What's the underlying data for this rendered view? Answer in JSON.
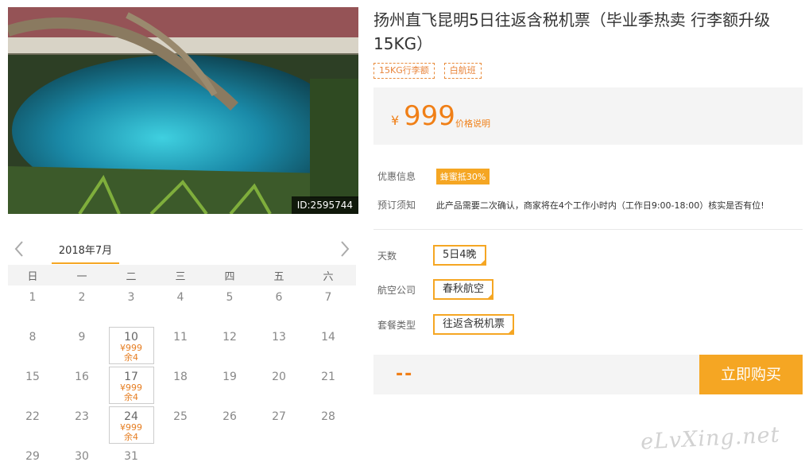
{
  "product": {
    "title": "扬州直飞昆明5日往返含税机票（毕业季热卖 行李额升级15KG）",
    "tags": [
      "15KG行李额",
      "白航班"
    ],
    "image_id": "ID:2595744"
  },
  "price": {
    "currency": "¥",
    "value": "999",
    "explain_label": "价格说明"
  },
  "info": {
    "promo_label": "优惠信息",
    "promo_badge": "蜂蜜抵30%",
    "notice_label": "预订须知",
    "notice_text": "此产品需要二次确认，商家将在4个工作小时内（工作日9:00-18:00）核实是否有位!"
  },
  "options": [
    {
      "label": "天数",
      "value": "5日4晚"
    },
    {
      "label": "航空公司",
      "value": "春秋航空"
    },
    {
      "label": "套餐类型",
      "value": "往返含税机票"
    }
  ],
  "buy": {
    "total": "--",
    "button_label": "立即购买"
  },
  "calendar": {
    "month_label": "2018年7月",
    "weekdays": [
      "日",
      "一",
      "二",
      "三",
      "四",
      "五",
      "六"
    ],
    "days": [
      {
        "d": "1"
      },
      {
        "d": "2"
      },
      {
        "d": "3"
      },
      {
        "d": "4"
      },
      {
        "d": "5"
      },
      {
        "d": "6"
      },
      {
        "d": "7"
      },
      {
        "d": "8"
      },
      {
        "d": "9"
      },
      {
        "d": "10",
        "price": "¥999",
        "left": "余4"
      },
      {
        "d": "11"
      },
      {
        "d": "12"
      },
      {
        "d": "13"
      },
      {
        "d": "14"
      },
      {
        "d": "15"
      },
      {
        "d": "16"
      },
      {
        "d": "17",
        "price": "¥999",
        "left": "余4"
      },
      {
        "d": "18"
      },
      {
        "d": "19"
      },
      {
        "d": "20"
      },
      {
        "d": "21"
      },
      {
        "d": "22"
      },
      {
        "d": "23"
      },
      {
        "d": "24",
        "price": "¥999",
        "left": "余4"
      },
      {
        "d": "25"
      },
      {
        "d": "26"
      },
      {
        "d": "27"
      },
      {
        "d": "28"
      },
      {
        "d": "29"
      },
      {
        "d": "30"
      },
      {
        "d": "31"
      }
    ]
  },
  "watermark": "eLvXing.net",
  "colors": {
    "accent": "#f5a623",
    "price": "#f07f16"
  },
  "icons": {
    "prev": "chevron-left-icon",
    "next": "chevron-right-icon",
    "selected": "check-icon"
  }
}
